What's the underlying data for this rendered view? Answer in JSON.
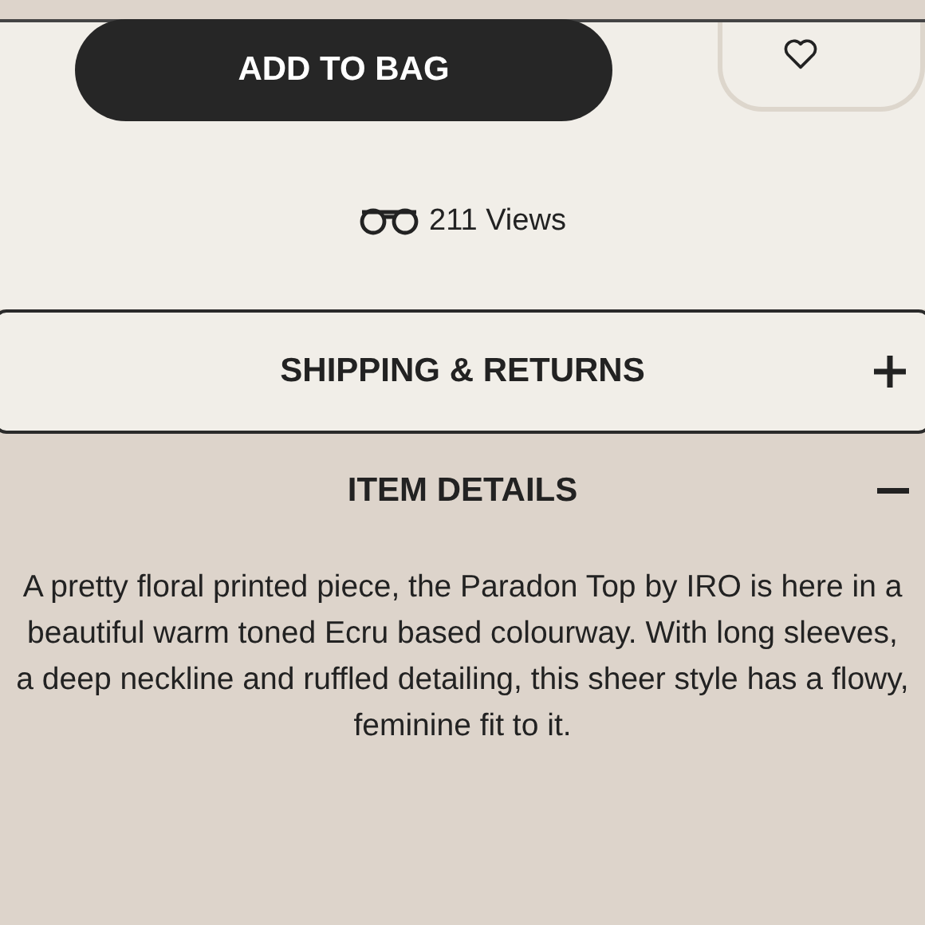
{
  "actions": {
    "add_to_bag": "ADD TO BAG"
  },
  "views": "211 Views",
  "accordion": [
    {
      "title": "SHIPPING & RETURNS",
      "expanded": false
    },
    {
      "title": "ITEM DETAILS",
      "expanded": true,
      "body": "A pretty floral printed piece, the Paradon Top by IRO is here in a beautiful warm toned Ecru based colourway. With long sleeves, a deep neckline and ruffled detailing, this sheer style has a flowy, feminine fit to it."
    }
  ]
}
